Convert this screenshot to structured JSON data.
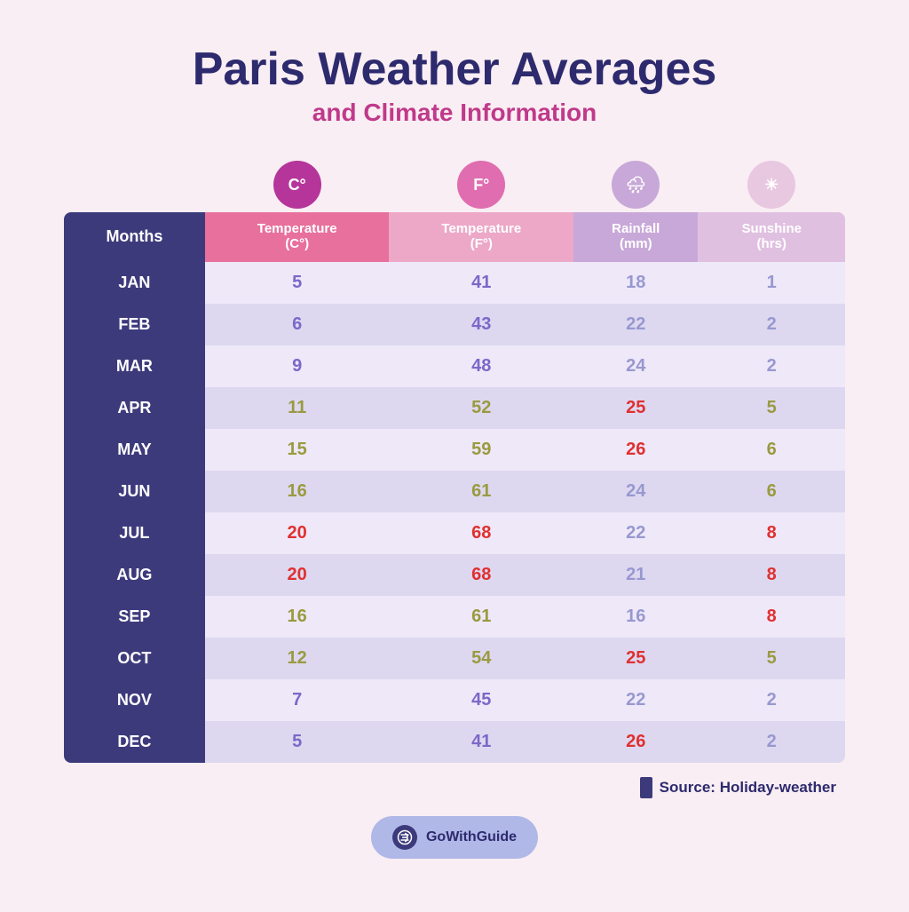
{
  "title": {
    "main": "Paris Weather Averages",
    "sub": "and Climate Information"
  },
  "header": {
    "months_label": "Months",
    "columns": [
      {
        "id": "temp_c",
        "icon": "C°",
        "label": "Temperature\n(C°)",
        "icon_style": "purple"
      },
      {
        "id": "temp_f",
        "icon": "F°",
        "label": "Temperature\n(F°)",
        "icon_style": "pink"
      },
      {
        "id": "rainfall",
        "icon": "🌧",
        "label": "Rainfall\n(mm)",
        "icon_style": "light-purple"
      },
      {
        "id": "sunshine",
        "icon": "☀",
        "label": "Sunshine\n(hrs)",
        "icon_style": "very-light"
      }
    ]
  },
  "rows": [
    {
      "month": "JAN",
      "temp_c": "5",
      "temp_c_color": "purple",
      "temp_f": "41",
      "temp_f_color": "purple",
      "rainfall": "18",
      "rainfall_color": "light-purple",
      "sunshine": "1",
      "sunshine_color": "light-purple"
    },
    {
      "month": "FEB",
      "temp_c": "6",
      "temp_c_color": "purple",
      "temp_f": "43",
      "temp_f_color": "purple",
      "rainfall": "22",
      "rainfall_color": "light-purple",
      "sunshine": "2",
      "sunshine_color": "light-purple"
    },
    {
      "month": "MAR",
      "temp_c": "9",
      "temp_c_color": "purple",
      "temp_f": "48",
      "temp_f_color": "purple",
      "rainfall": "24",
      "rainfall_color": "light-purple",
      "sunshine": "2",
      "sunshine_color": "light-purple"
    },
    {
      "month": "APR",
      "temp_c": "11",
      "temp_c_color": "olive",
      "temp_f": "52",
      "temp_f_color": "olive",
      "rainfall": "25",
      "rainfall_color": "red",
      "sunshine": "5",
      "sunshine_color": "olive"
    },
    {
      "month": "MAY",
      "temp_c": "15",
      "temp_c_color": "olive",
      "temp_f": "59",
      "temp_f_color": "olive",
      "rainfall": "26",
      "rainfall_color": "red",
      "sunshine": "6",
      "sunshine_color": "olive"
    },
    {
      "month": "JUN",
      "temp_c": "16",
      "temp_c_color": "olive",
      "temp_f": "61",
      "temp_f_color": "olive",
      "rainfall": "24",
      "rainfall_color": "light-purple",
      "sunshine": "6",
      "sunshine_color": "olive"
    },
    {
      "month": "JUL",
      "temp_c": "20",
      "temp_c_color": "red",
      "temp_f": "68",
      "temp_f_color": "red",
      "rainfall": "22",
      "rainfall_color": "light-purple",
      "sunshine": "8",
      "sunshine_color": "red"
    },
    {
      "month": "AUG",
      "temp_c": "20",
      "temp_c_color": "red",
      "temp_f": "68",
      "temp_f_color": "red",
      "rainfall": "21",
      "rainfall_color": "light-purple",
      "sunshine": "8",
      "sunshine_color": "red"
    },
    {
      "month": "SEP",
      "temp_c": "16",
      "temp_c_color": "olive",
      "temp_f": "61",
      "temp_f_color": "olive",
      "rainfall": "16",
      "rainfall_color": "light-purple",
      "sunshine": "8",
      "sunshine_color": "red"
    },
    {
      "month": "OCT",
      "temp_c": "12",
      "temp_c_color": "olive",
      "temp_f": "54",
      "temp_f_color": "olive",
      "rainfall": "25",
      "rainfall_color": "red",
      "sunshine": "5",
      "sunshine_color": "olive"
    },
    {
      "month": "NOV",
      "temp_c": "7",
      "temp_c_color": "purple",
      "temp_f": "45",
      "temp_f_color": "purple",
      "rainfall": "22",
      "rainfall_color": "light-purple",
      "sunshine": "2",
      "sunshine_color": "light-purple"
    },
    {
      "month": "DEC",
      "temp_c": "5",
      "temp_c_color": "purple",
      "temp_f": "41",
      "temp_f_color": "purple",
      "rainfall": "26",
      "rainfall_color": "red",
      "sunshine": "2",
      "sunshine_color": "light-purple"
    }
  ],
  "source": {
    "label": "Source: Holiday-weather"
  },
  "logo": {
    "text": "GoWithGuide"
  }
}
